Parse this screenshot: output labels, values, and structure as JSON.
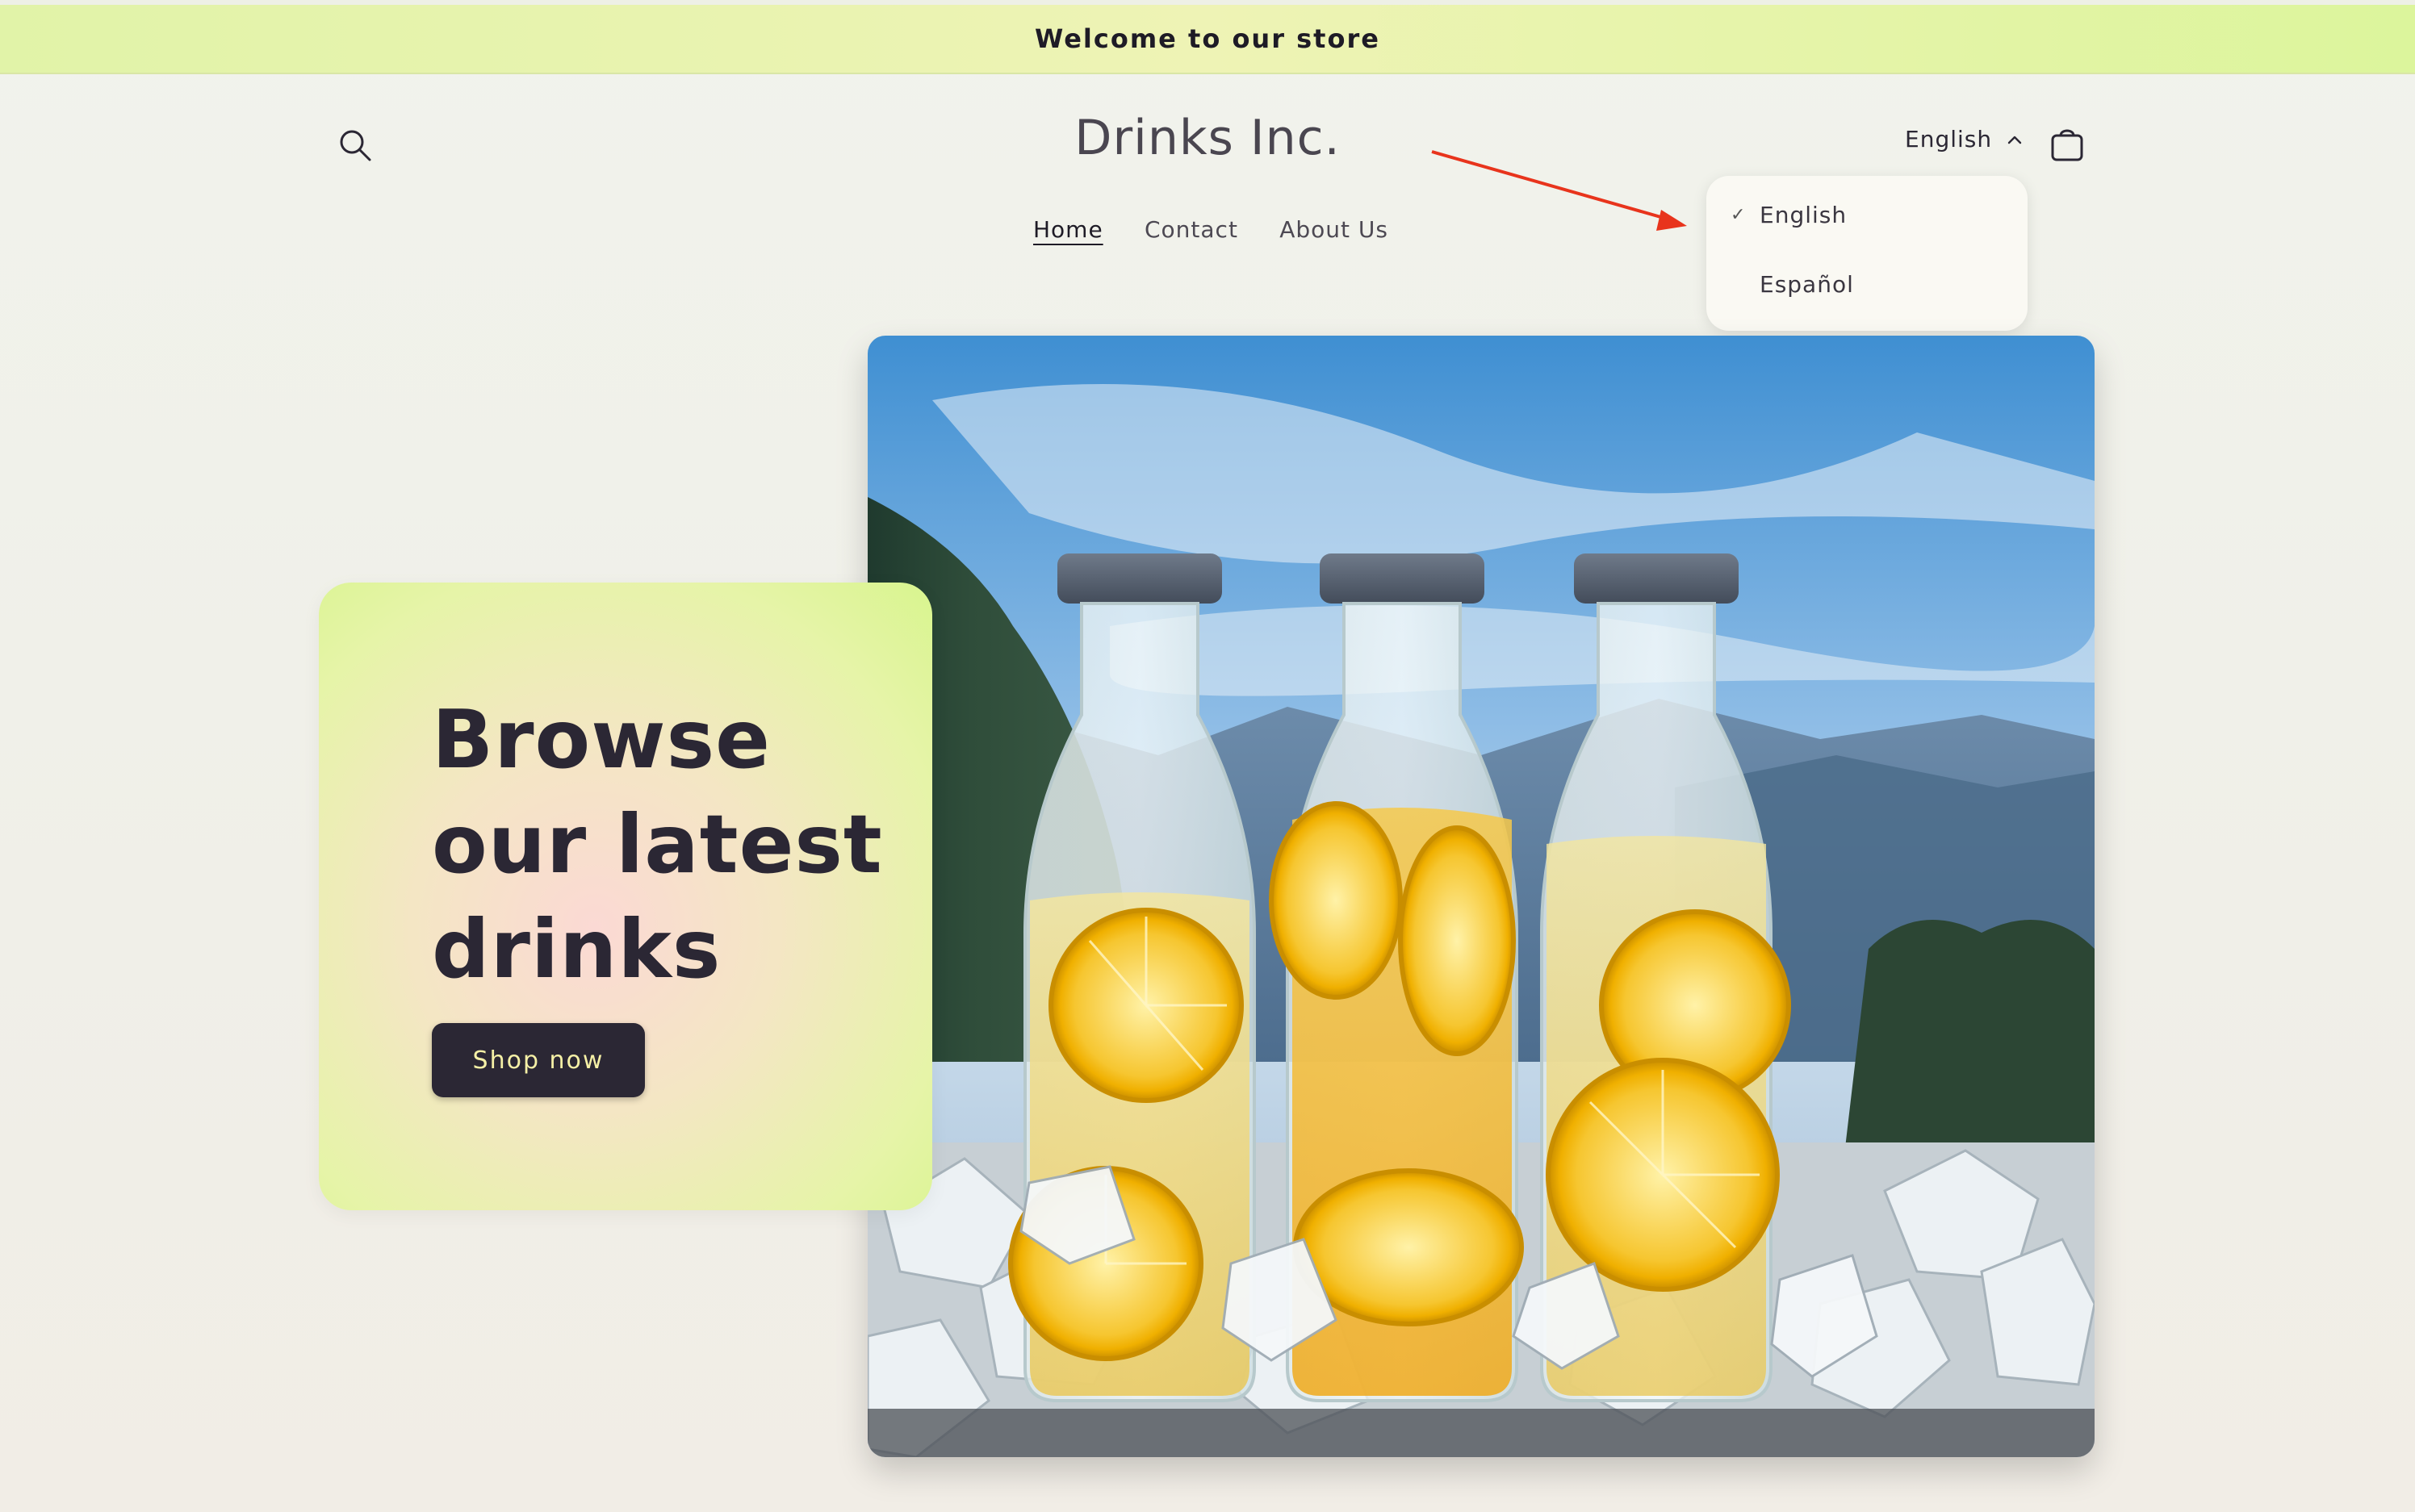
{
  "announcement": {
    "text": "Welcome to our store"
  },
  "header": {
    "logo": "Drinks Inc.",
    "nav": [
      {
        "label": "Home",
        "active": true
      },
      {
        "label": "Contact",
        "active": false
      },
      {
        "label": "About Us",
        "active": false
      }
    ],
    "language": {
      "current": "English",
      "options": [
        {
          "label": "English",
          "selected": true
        },
        {
          "label": "Español",
          "selected": false
        }
      ]
    }
  },
  "hero": {
    "title": "Browse our latest drinks",
    "button_label": "Shop now"
  },
  "colors": {
    "announcement_bg": "#e4f4a8",
    "button_bg": "#2b2734",
    "button_text": "#f5f0a6",
    "annotation_arrow": "#e8341c"
  },
  "icons": {
    "search": "search-icon",
    "cart": "cart-icon",
    "chevron": "chevron-up-icon",
    "check": "check-icon"
  }
}
